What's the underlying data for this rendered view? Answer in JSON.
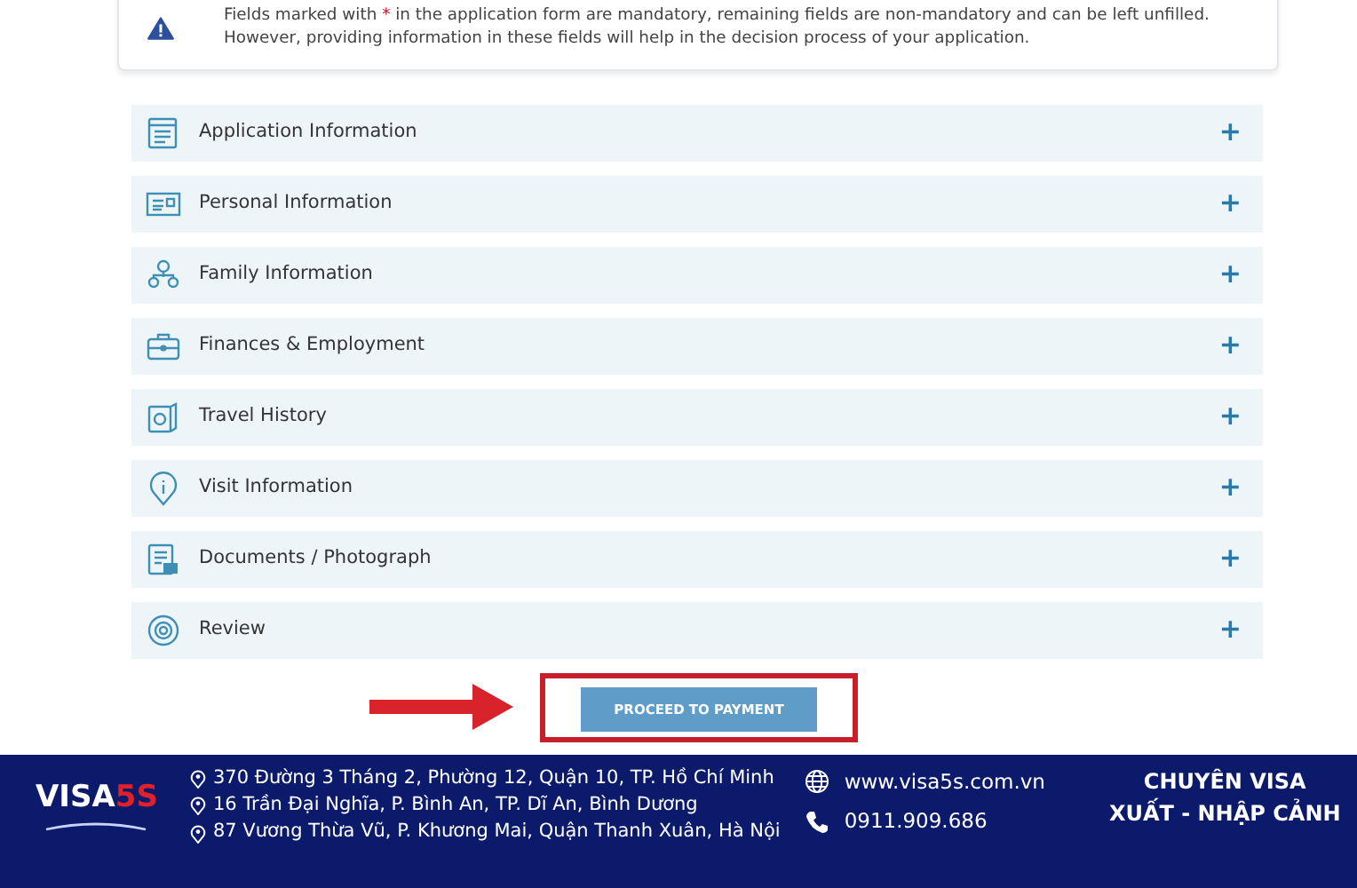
{
  "notice": {
    "before": "Fields marked with ",
    "mark": "*",
    "after": " in the application form are mandatory, remaining fields are non-mandatory and can be left unfilled. However, providing information in these fields will help in the decision process of your application."
  },
  "sections": [
    {
      "label": "Application Information",
      "kind": "form",
      "toggle": "+"
    },
    {
      "label": "Personal Information",
      "kind": "card",
      "toggle": "+"
    },
    {
      "label": "Family Information",
      "kind": "family",
      "toggle": "+"
    },
    {
      "label": "Finances & Employment",
      "kind": "briefcase",
      "toggle": "+"
    },
    {
      "label": "Travel History",
      "kind": "passport",
      "toggle": "+"
    },
    {
      "label": "Visit Information",
      "kind": "info",
      "toggle": "+"
    },
    {
      "label": "Documents / Photograph",
      "kind": "document",
      "toggle": "+"
    },
    {
      "label": "Review",
      "kind": "target",
      "toggle": "+"
    }
  ],
  "proceed_button": "PROCEED TO PAYMENT",
  "footer": {
    "logo": {
      "word": "VISA",
      "accent": "5S"
    },
    "addresses": [
      "370 Đường 3 Tháng 2, Phường 12, Quận 10, TP. Hồ Chí Minh",
      "16 Trần Đại Nghĩa, P. Bình An, TP. Dĩ An, Bình Dương",
      "87 Vương Thừa Vũ, P. Khương Mai, Quận Thanh Xuân, Hà Nội"
    ],
    "website": "www.visa5s.com.vn",
    "phone": "0911.909.686",
    "slogan": [
      "CHUYÊN VISA",
      "XUẤT - NHẬP CẢNH"
    ]
  }
}
